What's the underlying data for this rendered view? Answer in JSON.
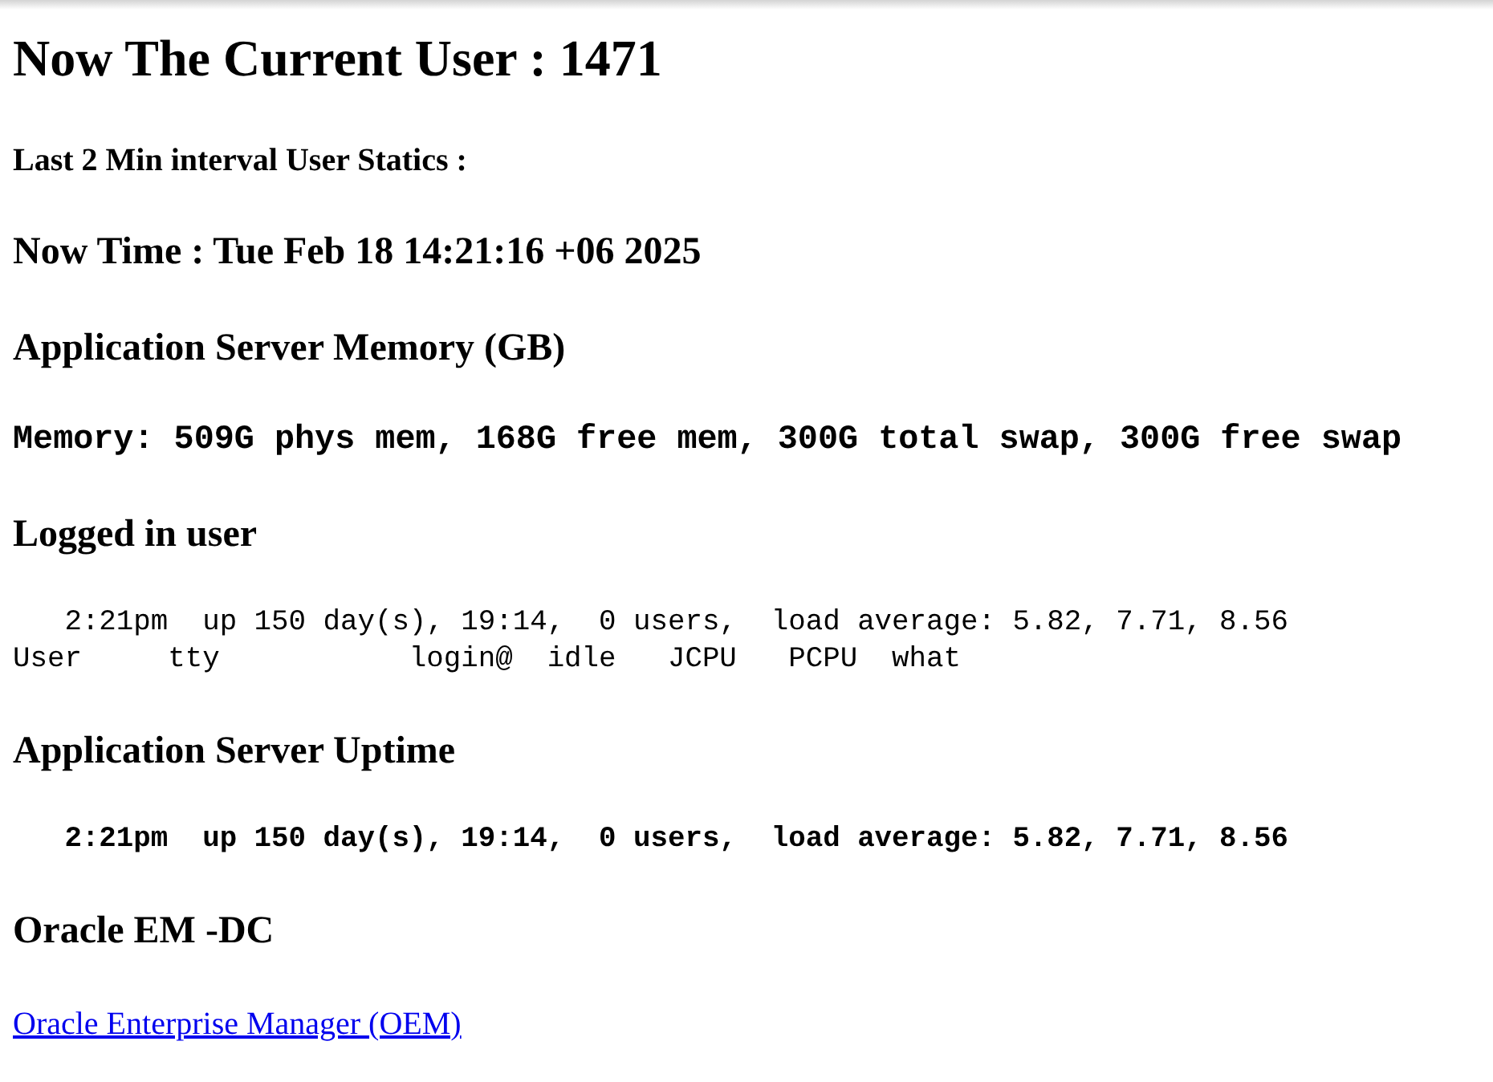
{
  "title": "Now The Current User : 1471",
  "subtitle": "Last 2 Min interval User Statics :",
  "blocks": [
    {
      "kind": "heading",
      "text": "Now Time : Tue Feb 18 14:21:16 +06 2025"
    },
    {
      "kind": "heading",
      "text": "Application Server Memory (GB)"
    },
    {
      "kind": "mono_bold",
      "text": "Memory: 509G phys mem, 168G free mem, 300G total swap, 300G free swap"
    },
    {
      "kind": "heading",
      "text": "Logged in user"
    },
    {
      "kind": "pre",
      "lines": [
        "   2:21pm  up 150 day(s), 19:14,  0 users,  load average: 5.82, 7.71, 8.56",
        "User     tty           login@  idle   JCPU   PCPU  what"
      ]
    },
    {
      "kind": "heading",
      "text": "Application Server Uptime"
    },
    {
      "kind": "pre_bold",
      "lines": [
        "   2:21pm  up 150 day(s), 19:14,  0 users,  load average: 5.82, 7.71, 8.56"
      ]
    },
    {
      "kind": "heading",
      "text": "Oracle EM -DC"
    },
    {
      "kind": "link",
      "text": "Oracle Enterprise Manager (OEM)"
    }
  ]
}
